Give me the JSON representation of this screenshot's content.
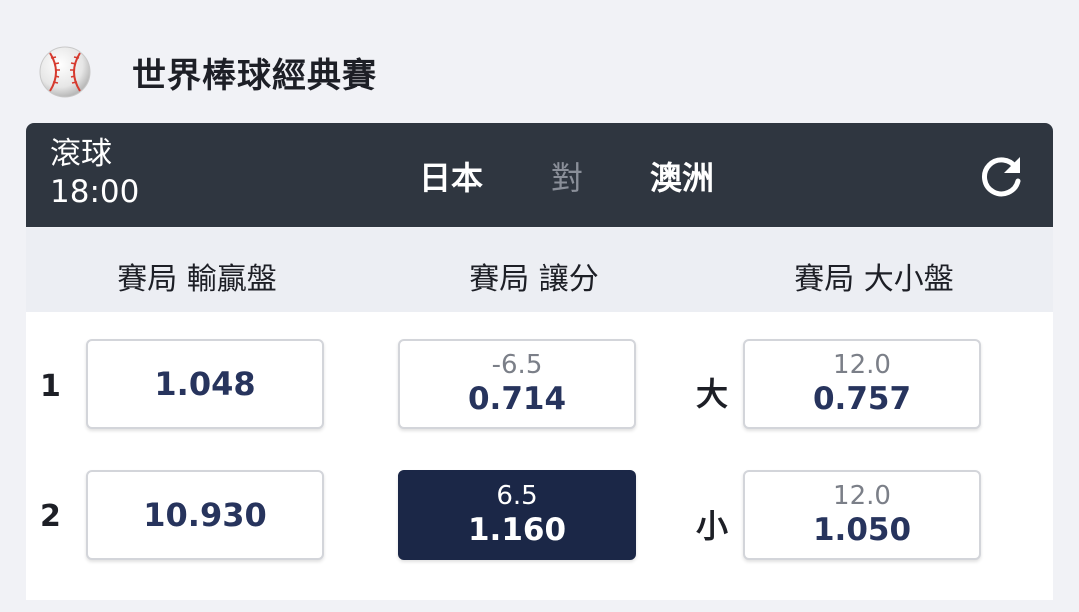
{
  "competition": {
    "title": "世界棒球經典賽",
    "icon": "baseball-icon"
  },
  "match": {
    "status": "滾球",
    "time": "18:00",
    "home": "日本",
    "vs": "對",
    "away": "澳洲",
    "refresh_icon": "refresh-icon"
  },
  "markets": {
    "moneyline": "賽局 輸贏盤",
    "handicap": "賽局 讓分",
    "total": "賽局 大小盤"
  },
  "rows": [
    {
      "label": "1",
      "moneyline": "1.048",
      "handicap_line": "-6.5",
      "handicap_price": "0.714",
      "total_side": "大",
      "total_line": "12.0",
      "total_price": "0.757"
    },
    {
      "label": "2",
      "moneyline": "10.930",
      "handicap_line": "6.5",
      "handicap_price": "1.160",
      "total_side": "小",
      "total_line": "12.0",
      "total_price": "1.050"
    }
  ],
  "colors": {
    "header_bar": "#2f3640",
    "selected": "#1b2747",
    "price": "#27345d"
  }
}
